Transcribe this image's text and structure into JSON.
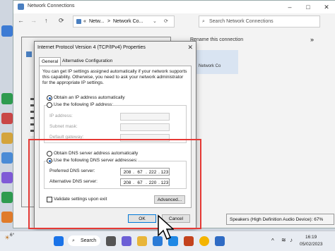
{
  "desktop": {
    "left_icon_colors": [
      "#3d7bd4",
      "#2e9b4f",
      "#c94747",
      "#d4a43d",
      "#4b8bd6",
      "#7f5ad6",
      "#2e9b4f",
      "#e07b2a"
    ]
  },
  "net_window": {
    "title": "Network Connections",
    "addr_prefix": "«",
    "addr_part1": "Netw...",
    "addr_sep": ">",
    "addr_part2": "Network Co...",
    "search_placeholder": "Search Network Connections",
    "rename_label": "Rename this connection",
    "card_label": "Network Co"
  },
  "dialog": {
    "title": "Internet Protocol Version 4 (TCP/IPv4) Properties",
    "close": "✕",
    "tabs": [
      "General",
      "Alternative Configuration"
    ],
    "intro": [
      "You can get IP settings assigned automatically if your network supports",
      "this capability. Otherwise, you need to ask your network administrator",
      "for the appropriate IP settings."
    ],
    "ip_auto_label": "Obtain an IP address automatically",
    "ip_manual_label": "Use the following IP address:",
    "ip_fields": [
      "IP address:",
      "Subnet mask:",
      "Default gateway:"
    ],
    "dns_auto_label": "Obtain DNS server address automatically",
    "dns_manual_label": "Use the following DNS server addresses:",
    "preferred_label": "Preferred DNS server:",
    "alternate_label": "Alternative DNS server:",
    "preferred_dns": [
      "208",
      "67",
      "222",
      "123"
    ],
    "alternate_dns": [
      "208",
      "67",
      "220",
      "123"
    ],
    "validate_label": "Validate settings upon exit",
    "advanced_button": "Advanced...",
    "ok_button": "OK",
    "cancel_button": "Cancel"
  },
  "tooltip": "Speakers (High Definition Audio Device): 67%",
  "taskbar": {
    "weather": "6°",
    "search_label": "Search",
    "time": "16:19",
    "date": "05/02/2023"
  },
  "colors": {
    "highlight": "#e53935",
    "accent": "#0078d7"
  }
}
